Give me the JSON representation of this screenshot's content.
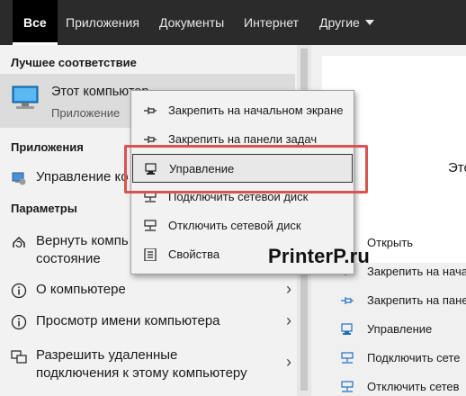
{
  "tabs": [
    {
      "label": "Все"
    },
    {
      "label": "Приложения"
    },
    {
      "label": "Документы"
    },
    {
      "label": "Интернет"
    },
    {
      "label": "Другие"
    }
  ],
  "best_match": {
    "heading": "Лучшее соответствие",
    "title": "Этот компьютер",
    "subtitle": "Приложение"
  },
  "apps": {
    "heading": "Приложения",
    "items": [
      {
        "label": "Управление ко"
      }
    ]
  },
  "settings": {
    "heading": "Параметры",
    "items": [
      {
        "line1": "Вернуть компь",
        "line2": "состояние"
      },
      {
        "label": "О компьютере"
      },
      {
        "label": "Просмотр имени компьютера"
      },
      {
        "line1": "Разрешить удаленные",
        "line2": "подключения к этому компьютеру"
      }
    ]
  },
  "context_menu": {
    "items": [
      {
        "label": "Закрепить на начальном экране",
        "icon": "pin-icon"
      },
      {
        "label": "Закрепить на панели задач",
        "icon": "pin-icon"
      },
      {
        "label": "Управление",
        "icon": "manage-icon"
      },
      {
        "label": "Подключить сетевой диск",
        "icon": "network-drive-icon"
      },
      {
        "label": "Отключить сетевой диск",
        "icon": "network-drive-icon"
      },
      {
        "label": "Свойства",
        "icon": "properties-icon"
      }
    ]
  },
  "preview": {
    "title": "Это",
    "actions": [
      {
        "label": "Открыть"
      },
      {
        "label": "Закрепить на нача"
      },
      {
        "label": "Закрепить на пане"
      },
      {
        "label": "Управление"
      },
      {
        "label": "Подключить сете"
      },
      {
        "label": "Отключить сетев"
      }
    ]
  },
  "watermark": "PrinterP.ru",
  "colors": {
    "topbar": "#2b2b2b",
    "accent_blue": "#1e6fc4",
    "highlight_red": "#d9534f"
  }
}
